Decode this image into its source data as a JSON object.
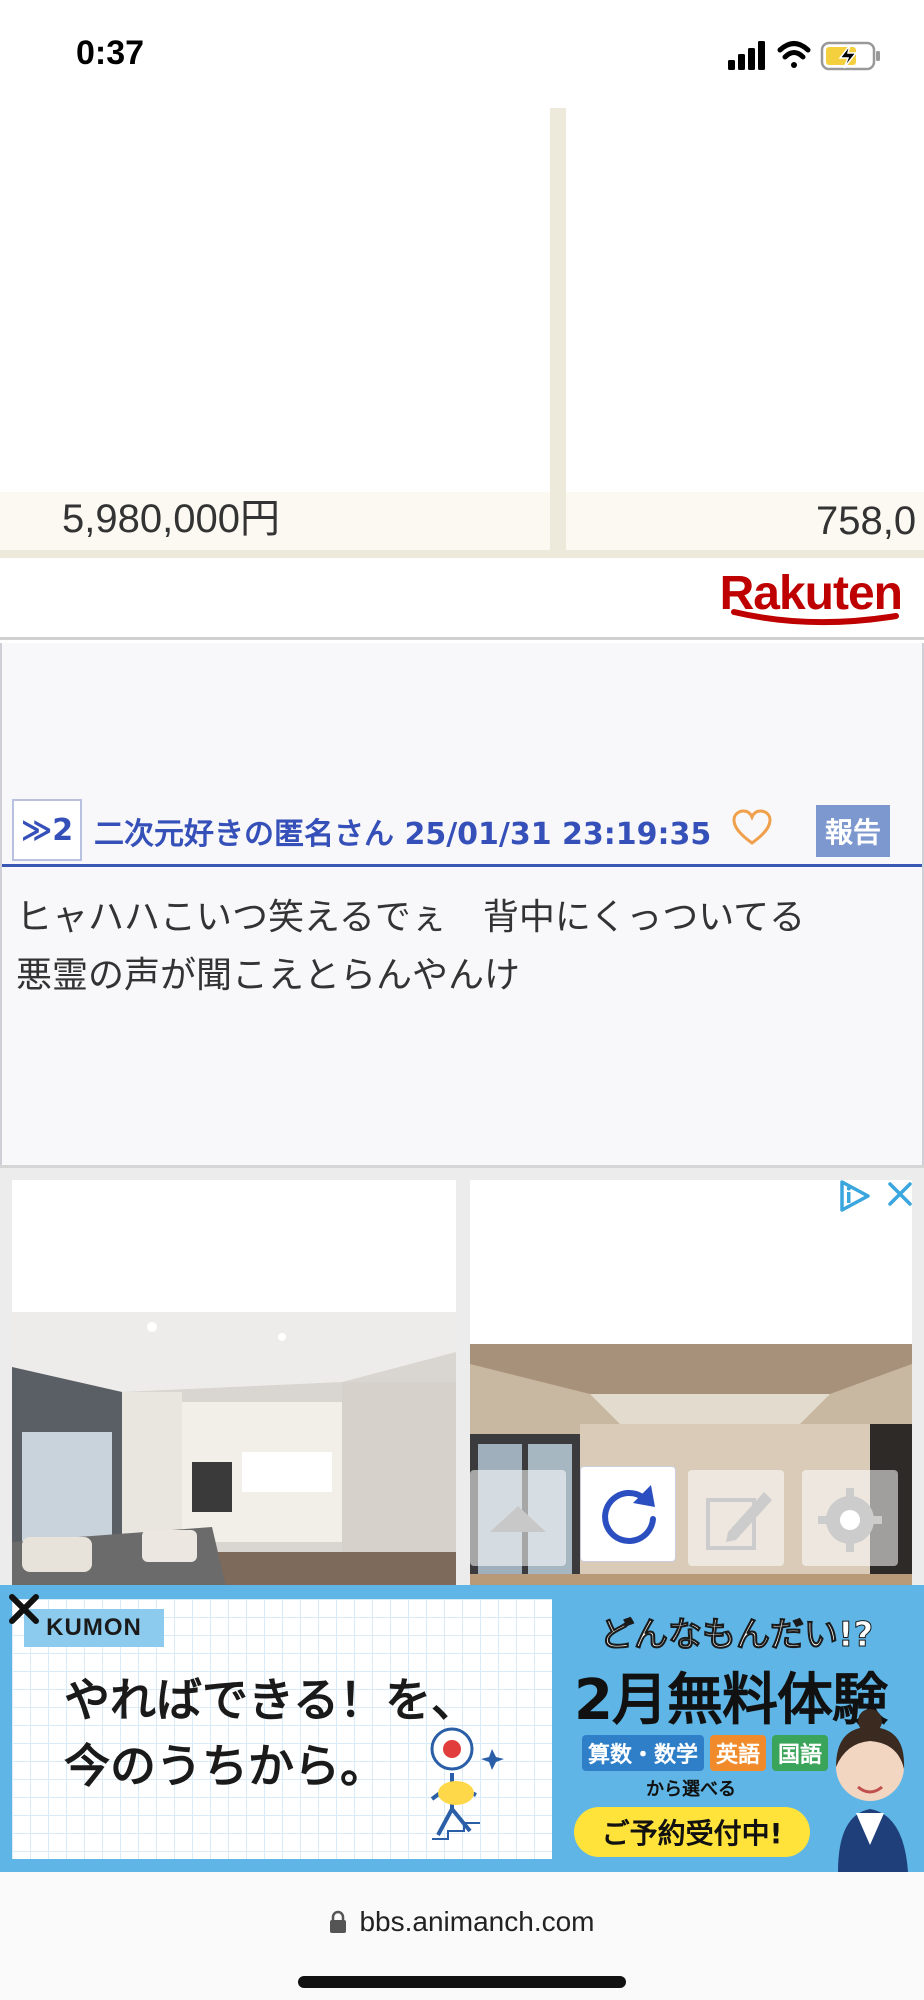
{
  "status_bar": {
    "time": "0:37"
  },
  "rakuten_ad": {
    "products": [
      {
        "price": "5,980,000円"
      },
      {
        "price": "758,0"
      }
    ],
    "logo": "Rakuten",
    "brand_color": "#bf0000"
  },
  "post": {
    "anchor": "≫2",
    "author": "二次元好きの匿名さん",
    "timestamp": "25/01/31 23:19:35",
    "report_label": "報告",
    "body": "ヒャハハこいつ笑えるでぇ　背中にくっついてる\n悪霊の声が聞こえとらんやんけ",
    "accent_color": "#3550b8"
  },
  "property_ad": {
    "icons": [
      "adchoices-icon",
      "close-icon"
    ],
    "toolbar": [
      "scroll-up-icon",
      "reload-icon",
      "edit-icon",
      "settings-icon"
    ]
  },
  "kumon_ad": {
    "logo": "KUMON",
    "copy": "やればできる！を、\n今のうちから。",
    "question": "どんなもんだい!?",
    "headline": "2月無料体験",
    "subjects": [
      {
        "label": "算数・数学",
        "color": "#2f7fc8"
      },
      {
        "label": "英語",
        "color": "#f08a2a"
      },
      {
        "label": "国語",
        "color": "#3aa55a"
      }
    ],
    "choose": "から選べる",
    "cta": "ご予約受付中!"
  },
  "browser": {
    "url": "bbs.animanch.com"
  }
}
